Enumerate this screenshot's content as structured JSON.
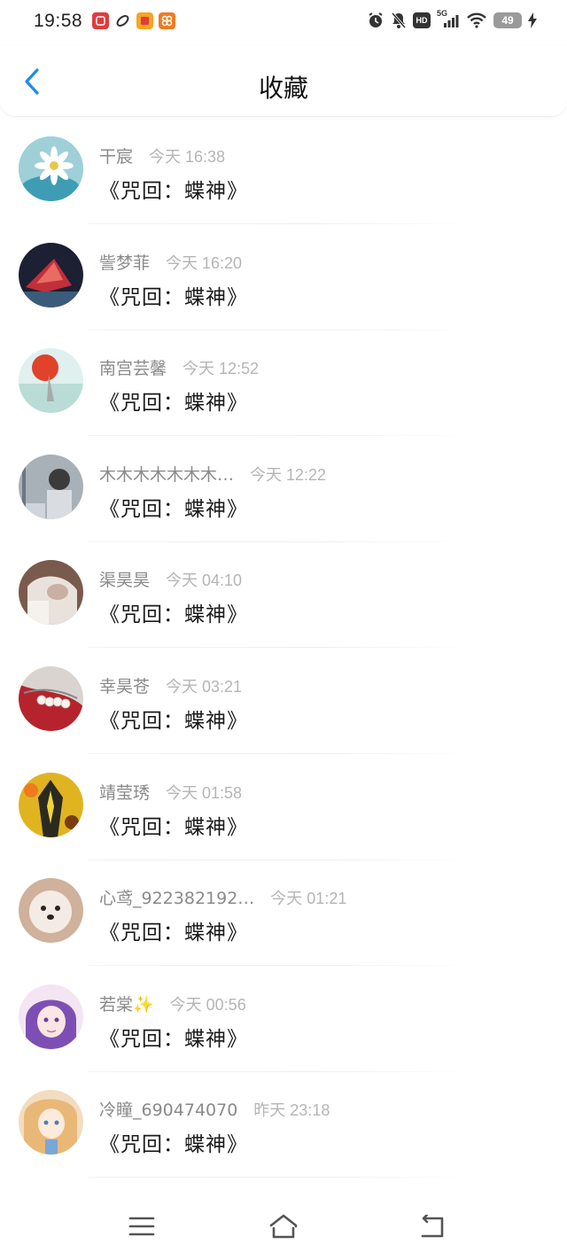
{
  "status": {
    "time": "19:58",
    "battery": "49",
    "network": "5G",
    "hd": "HD"
  },
  "header": {
    "title": "收藏"
  },
  "items": [
    {
      "name": "干宸",
      "time": "今天 16:38",
      "title": "《咒回：蝶神》",
      "avatar": {
        "bg": "#6fb8c9",
        "fg": "#ffffff"
      }
    },
    {
      "name": "訾梦菲",
      "time": "今天 16:20",
      "title": "《咒回：蝶神》",
      "avatar": {
        "bg": "#1d1f33",
        "fg": "#c0303a"
      }
    },
    {
      "name": "南宫芸馨",
      "time": "今天 12:52",
      "title": "《咒回：蝶神》",
      "avatar": {
        "bg": "#cfe6e4",
        "fg": "#e0422b"
      }
    },
    {
      "name": "木木木木木木木…",
      "time": "今天 12:22",
      "title": "《咒回：蝶神》",
      "avatar": {
        "bg": "#9aa3ad",
        "fg": "#3b3b3b"
      }
    },
    {
      "name": "渠昊昊",
      "time": "今天 04:10",
      "title": "《咒回：蝶神》",
      "avatar": {
        "bg": "#8a6a5a",
        "fg": "#e9e2dc"
      }
    },
    {
      "name": "幸昊苍",
      "time": "今天 03:21",
      "title": "《咒回：蝶神》",
      "avatar": {
        "bg": "#b5242c",
        "fg": "#f1ece6"
      }
    },
    {
      "name": "靖莹琇",
      "time": "今天 01:58",
      "title": "《咒回：蝶神》",
      "avatar": {
        "bg": "#2a2a20",
        "fg": "#e8c21c"
      }
    },
    {
      "name": "心鸢_922382192…",
      "time": "今天 01:21",
      "title": "《咒回：蝶神》",
      "avatar": {
        "bg": "#d2b6a2",
        "fg": "#f4ece4"
      }
    },
    {
      "name": "若棠✨",
      "time": "今天 00:56",
      "title": "《咒回：蝶神》",
      "avatar": {
        "bg": "#9b6fc7",
        "fg": "#f3dff2"
      }
    },
    {
      "name": "冷瞳_690474070",
      "time": "昨天 23:18",
      "title": "《咒回：蝶神》",
      "avatar": {
        "bg": "#e9c79a",
        "fg": "#7aa7d6"
      }
    }
  ],
  "icons": {
    "back": "chevron-left-icon",
    "menu": "menu-icon",
    "home": "home-icon",
    "back_nav": "back-icon"
  },
  "colors": {
    "accent": "#1e8ce8"
  }
}
